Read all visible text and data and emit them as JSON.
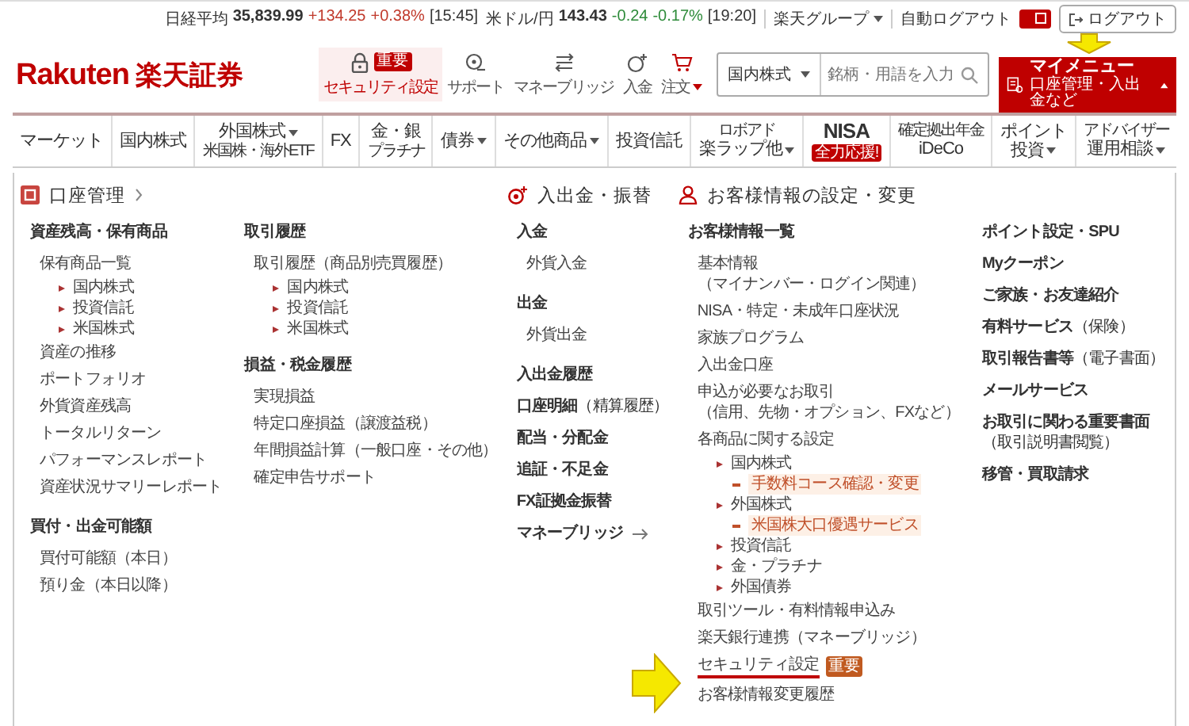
{
  "topbar": {
    "tickers": [
      {
        "label": "日経平均",
        "value": "35,839.99",
        "change": "+134.25",
        "pct": "+0.38%",
        "time": "[15:45]",
        "color": "#c0392b"
      },
      {
        "label": "米ドル/円",
        "value": "143.43",
        "change": "-0.24",
        "pct": "-0.17%",
        "time": "[19:20]",
        "color": "#2e8b3a"
      }
    ],
    "group_menu": "楽天グループ",
    "auto_logout": {
      "label": "自動ログアウト",
      "on": true
    },
    "logout": "ログアウト"
  },
  "header": {
    "logo": {
      "latin": "Rakuten",
      "jp": "楽天証券"
    },
    "shortcuts": [
      {
        "kind": "lock",
        "label": "セキュリティ設定",
        "badge": "重要",
        "highlighted": true,
        "dropdown": false
      },
      {
        "kind": "support",
        "label": "サポート",
        "highlighted": false,
        "dropdown": false
      },
      {
        "kind": "bridge",
        "label": "マネーブリッジ",
        "highlighted": false,
        "dropdown": false
      },
      {
        "kind": "deposit",
        "label": "入金",
        "highlighted": false,
        "dropdown": false
      },
      {
        "kind": "cart",
        "label": "注文",
        "highlighted": false,
        "dropdown": true
      }
    ],
    "search": {
      "category": "国内株式",
      "placeholder": "銘柄・用語を入力"
    },
    "my_menu": {
      "title": "マイメニュー",
      "subtitle": "口座管理・入出金など",
      "expanded": true
    }
  },
  "nav": [
    {
      "label": "マーケット",
      "dropdown": false
    },
    {
      "label": "国内株式",
      "dropdown": false
    },
    {
      "label": "外国株式",
      "sub": "米国株・海外ETF",
      "dropdown": true
    },
    {
      "label": "FX",
      "dropdown": false
    },
    {
      "label": "金・銀",
      "sub": "プラチナ",
      "dropdown": false
    },
    {
      "label": "債券",
      "dropdown": true
    },
    {
      "label": "その他商品",
      "dropdown": true
    },
    {
      "label": "投資信託",
      "dropdown": false
    },
    {
      "top": "ロボアド",
      "label": "楽ラップ他",
      "dropdown": true
    },
    {
      "label": "NISA",
      "badge": "全力応援!",
      "dropdown": false
    },
    {
      "top": "確定拠出年金",
      "label": "iDeCo",
      "dropdown": false
    },
    {
      "label": "ポイント",
      "label2": "投資",
      "dropdown": true
    },
    {
      "top": "アドバイザー",
      "label": "運用相談",
      "dropdown": true
    }
  ],
  "sections": [
    {
      "title": "口座管理",
      "kind": "account",
      "chevron": true,
      "columns": [
        [
          {
            "kind": "heading",
            "text": "資産残高・保有商品"
          },
          {
            "kind": "link",
            "text": "保有商品一覧"
          },
          {
            "kind": "bullet",
            "text": "国内株式"
          },
          {
            "kind": "bullet",
            "text": "投資信託"
          },
          {
            "kind": "bullet",
            "text": "米国株式"
          },
          {
            "kind": "link",
            "text": "資産の推移"
          },
          {
            "kind": "link",
            "text": "ポートフォリオ"
          },
          {
            "kind": "link",
            "text": "外貨資産残高"
          },
          {
            "kind": "link",
            "text": "トータルリターン"
          },
          {
            "kind": "link",
            "text": "パフォーマンスレポート"
          },
          {
            "kind": "link",
            "text": "資産状況サマリーレポート"
          },
          {
            "kind": "heading",
            "text": "買付・出金可能額"
          },
          {
            "kind": "link",
            "text": "買付可能額",
            "note": "（本日）"
          },
          {
            "kind": "link",
            "text": "預り金",
            "note": "（本日以降）"
          }
        ],
        [
          {
            "kind": "heading",
            "text": "取引履歴"
          },
          {
            "kind": "link",
            "text": "取引履歴",
            "note": "（商品別売買履歴）"
          },
          {
            "kind": "bullet",
            "text": "国内株式"
          },
          {
            "kind": "bullet",
            "text": "投資信託"
          },
          {
            "kind": "bullet",
            "text": "米国株式"
          },
          {
            "kind": "heading",
            "text": "損益・税金履歴"
          },
          {
            "kind": "link",
            "text": "実現損益"
          },
          {
            "kind": "link",
            "text": "特定口座損益",
            "note": "（譲渡益税）"
          },
          {
            "kind": "link",
            "text": "年間損益計算",
            "note": "（一般口座・その他）"
          },
          {
            "kind": "link",
            "text": "確定申告サポート"
          }
        ]
      ]
    },
    {
      "title": "入出金・振替",
      "kind": "coin",
      "chevron": false,
      "columns": [
        [
          {
            "kind": "heading",
            "text": "入金"
          },
          {
            "kind": "link",
            "text": "外貨入金"
          },
          {
            "kind": "heading",
            "text": "出金"
          },
          {
            "kind": "link",
            "text": "外貨出金"
          },
          {
            "kind": "heading",
            "text": "入出金履歴"
          },
          {
            "kind": "heading",
            "text": "口座明細",
            "note": "（精算履歴）"
          },
          {
            "kind": "heading",
            "text": "配当・分配金"
          },
          {
            "kind": "heading",
            "text": "追証・不足金"
          },
          {
            "kind": "heading",
            "text": "FX証拠金振替"
          },
          {
            "kind": "heading",
            "text": "マネーブリッジ",
            "arrow": true
          }
        ]
      ]
    },
    {
      "title": "お客様情報の設定・変更",
      "kind": "person",
      "chevron": false,
      "columns": [
        [
          {
            "kind": "heading",
            "text": "お客様情報一覧"
          },
          {
            "kind": "link",
            "text": "基本情報",
            "subnote": "（マイナンバー・ログイン関連）"
          },
          {
            "kind": "link",
            "text": "NISA・特定・未成年口座状況"
          },
          {
            "kind": "link",
            "text": "家族プログラム"
          },
          {
            "kind": "link",
            "text": "入出金口座"
          },
          {
            "kind": "link",
            "text": "申込が必要なお取引",
            "subnote": "（信用、先物・オプション、FXなど）"
          },
          {
            "kind": "link",
            "text": "各商品に関する設定"
          },
          {
            "kind": "bullet",
            "text": "国内株式"
          },
          {
            "kind": "dash",
            "text": "手数料コース確認・変更"
          },
          {
            "kind": "bullet",
            "text": "外国株式"
          },
          {
            "kind": "dash",
            "text": "米国株大口優遇サービス"
          },
          {
            "kind": "bullet",
            "text": "投資信託"
          },
          {
            "kind": "bullet",
            "text": "金・プラチナ"
          },
          {
            "kind": "bullet",
            "text": "外国債券"
          },
          {
            "kind": "link",
            "text": "取引ツール・有料情報申込み"
          },
          {
            "kind": "link",
            "text": "楽天銀行連携",
            "note": "（マネーブリッジ）"
          },
          {
            "kind": "link",
            "text": "セキュリティ設定",
            "badge": "重要",
            "underlined": true
          },
          {
            "kind": "link",
            "text": "お客様情報変更履歴"
          }
        ],
        [
          {
            "kind": "heading",
            "text": "ポイント設定・SPU"
          },
          {
            "kind": "heading",
            "text": "Myクーポン"
          },
          {
            "kind": "heading",
            "text": "ご家族・お友達紹介"
          },
          {
            "kind": "heading",
            "text": "有料サービス",
            "note": "（保険）"
          },
          {
            "kind": "heading",
            "text": "取引報告書等",
            "note": "（電子書面）"
          },
          {
            "kind": "heading",
            "text": "メールサービス"
          },
          {
            "kind": "heading",
            "text": "お取引に関わる重要書面",
            "subnote": "（取引説明書閲覧）"
          },
          {
            "kind": "heading",
            "text": "移管・買取請求"
          }
        ]
      ]
    }
  ]
}
